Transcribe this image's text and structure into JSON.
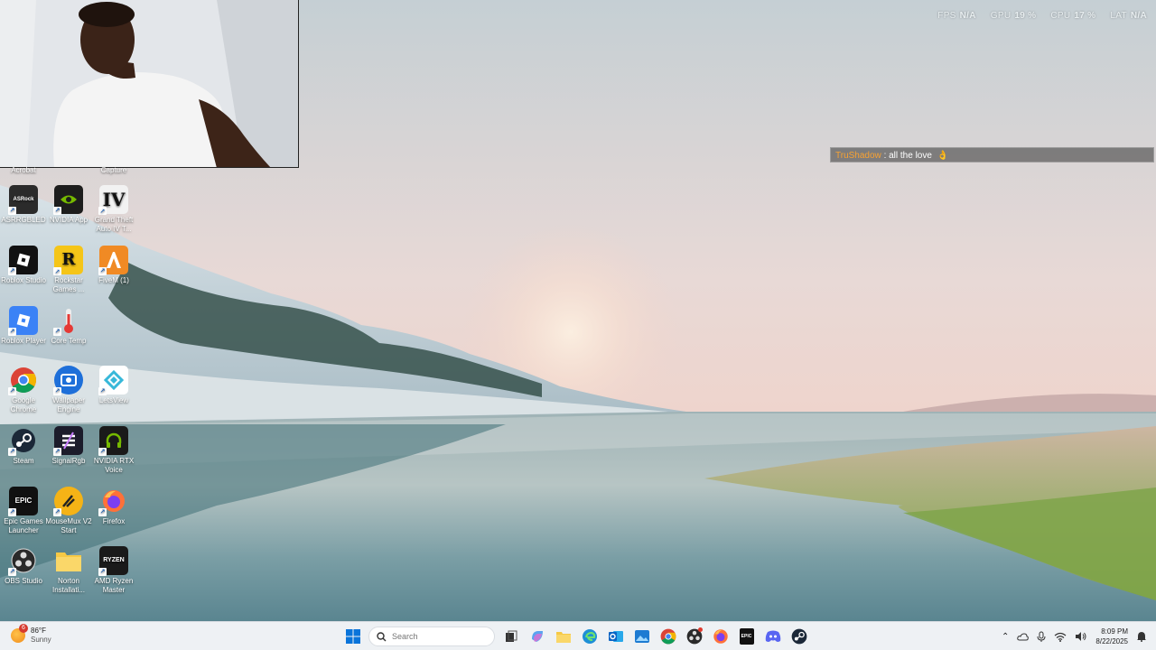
{
  "stats": [
    {
      "label": "FPS",
      "value": "N/A"
    },
    {
      "label": "GPU",
      "value": "19 %"
    },
    {
      "label": "CPU",
      "value": "17 %"
    },
    {
      "label": "LAT",
      "value": "N/A"
    }
  ],
  "chat": {
    "user": "TruShadow",
    "separator": ":",
    "message": "all the love",
    "emoji": "👌"
  },
  "desktop": {
    "cut_labels": [
      "Acrobat",
      "Capture"
    ],
    "icons": [
      {
        "label": "ASRRGBLED",
        "icon": "asrock-rgb-icon",
        "color": "#2b2b2b"
      },
      {
        "label": "NVIDIA App",
        "icon": "nvidia-icon",
        "color": "#1d1d1d"
      },
      {
        "label": "Grand Theft Auto IV T...",
        "icon": "gta-iv-icon",
        "color": "#f2f2f2"
      },
      {
        "label": "Roblox Studio",
        "icon": "roblox-studio-icon",
        "color": "#111111"
      },
      {
        "label": "Rockstar Games ...",
        "icon": "rockstar-icon",
        "color": "#f5c518"
      },
      {
        "label": "FiveM (1)",
        "icon": "fivem-icon",
        "color": "#f08a24"
      },
      {
        "label": "Roblox Player",
        "icon": "roblox-player-icon",
        "color": "#3b82f6"
      },
      {
        "label": "Core Temp",
        "icon": "thermometer-icon",
        "color": "#e53935"
      },
      {
        "label": "Google Chrome",
        "icon": "chrome-icon",
        "color": "#4285f4"
      },
      {
        "label": "Wallpaper Engine",
        "icon": "wallpaper-engine-icon",
        "color": "#1e6fd9"
      },
      {
        "label": "LetsView",
        "icon": "letsview-icon",
        "color": "#ffffff"
      },
      {
        "label": "Steam",
        "icon": "steam-icon",
        "color": "#1b2838"
      },
      {
        "label": "SignalRgb",
        "icon": "signalrgb-icon",
        "color": "#1c1c2b"
      },
      {
        "label": "NVIDIA RTX Voice",
        "icon": "headset-icon",
        "color": "#1a1a1a"
      },
      {
        "label": "Epic Games Launcher",
        "icon": "epic-games-icon",
        "color": "#111111"
      },
      {
        "label": "MouseMux V2 Start",
        "icon": "mousemux-icon",
        "color": "#f5b316"
      },
      {
        "label": "Firefox",
        "icon": "firefox-icon",
        "color": "#ff7139"
      },
      {
        "label": "OBS Studio",
        "icon": "obs-icon",
        "color": "#2a2a2a"
      },
      {
        "label": "Norton Installati...",
        "icon": "folder-icon",
        "color": "#f6c945"
      },
      {
        "label": "AMD Ryzen Master",
        "icon": "ryzen-icon",
        "color": "#1a1a1a"
      }
    ]
  },
  "taskbar": {
    "weather": {
      "temp": "86°F",
      "condition": "Sunny",
      "badge": "6"
    },
    "search": {
      "placeholder": "Search"
    },
    "pinned": [
      {
        "name": "start-button",
        "icon": "windows-icon"
      },
      {
        "name": "search-box"
      },
      {
        "name": "task-view",
        "icon": "task-view-icon"
      },
      {
        "name": "copilot",
        "icon": "copilot-icon"
      },
      {
        "name": "file-explorer",
        "icon": "folder-icon"
      },
      {
        "name": "edge",
        "icon": "edge-icon"
      },
      {
        "name": "outlook",
        "icon": "outlook-icon"
      },
      {
        "name": "photos",
        "icon": "photos-icon"
      },
      {
        "name": "chrome",
        "icon": "chrome-icon"
      },
      {
        "name": "obs",
        "icon": "obs-icon"
      },
      {
        "name": "firefox",
        "icon": "firefox-icon"
      },
      {
        "name": "epic-games",
        "icon": "epic-games-icon"
      },
      {
        "name": "discord",
        "icon": "discord-icon"
      },
      {
        "name": "steam",
        "icon": "steam-icon"
      }
    ],
    "clock": {
      "time": "8:09 PM",
      "date": "8/22/2025"
    }
  }
}
